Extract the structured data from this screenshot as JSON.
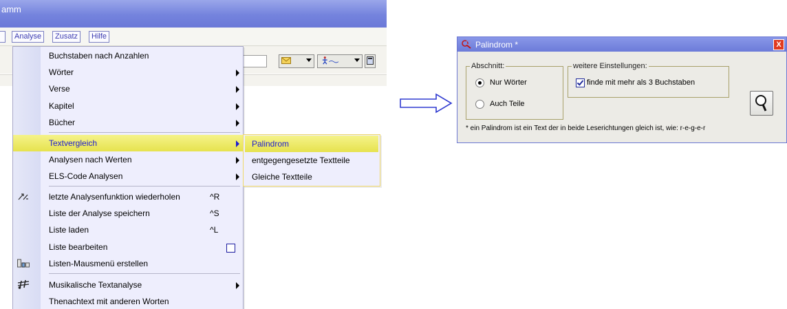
{
  "app": {
    "title_fragment": "amm",
    "menubar": [
      "Analyse",
      "Zusatz",
      "Hilfe"
    ],
    "colors": {
      "titlebar": "#7483dd",
      "highlight": "#e6e24e",
      "highlight_text": "#1d1dd0"
    }
  },
  "menu": {
    "items": [
      {
        "label": "Buchstaben nach Anzahlen"
      },
      {
        "label": "Wörter",
        "submenu": true
      },
      {
        "label": "Verse",
        "submenu": true
      },
      {
        "label": "Kapitel",
        "submenu": true
      },
      {
        "label": "Bücher",
        "submenu": true
      },
      {
        "label": "Textvergleich",
        "submenu": true,
        "highlighted": true
      },
      {
        "label": "Analysen nach Werten",
        "submenu": true
      },
      {
        "label": "ELS-Code Analysen",
        "submenu": true
      },
      {
        "label": "letzte Analysenfunktion wiederholen",
        "shortcut": "^R",
        "icon": "repeat-icon"
      },
      {
        "label": "Liste der Analyse speichern",
        "shortcut": "^S"
      },
      {
        "label": "Liste laden",
        "shortcut": "^L"
      },
      {
        "label": "Liste bearbeiten",
        "checkbox": true
      },
      {
        "label": "Listen-Mausmenü erstellen",
        "icon": "list-menu-icon"
      },
      {
        "label": "Musikalische Textanalyse",
        "submenu": true,
        "icon": "music-icon"
      },
      {
        "label": "Thenachtext mit anderen Worten"
      }
    ]
  },
  "submenu": {
    "items": [
      "Palindrom",
      "entgegengesetzte Textteile",
      "Gleiche Textteile"
    ],
    "highlighted_index": 0
  },
  "dialog": {
    "title": "Palindrom *",
    "close_label": "X",
    "abschnitt": {
      "caption": "Abschnitt:",
      "options": [
        "Nur Wörter",
        "Auch Teile"
      ],
      "selected": 0
    },
    "settings": {
      "caption": "weitere Einstellungen:",
      "checkbox_label": "finde mit mehr als 3 Buchstaben",
      "checked": true
    },
    "search_button": "search-icon",
    "footnote": "* ein Palindrom ist ein Text der in beide Leserichtungen gleich ist, wie: r-e-g-e-r"
  }
}
